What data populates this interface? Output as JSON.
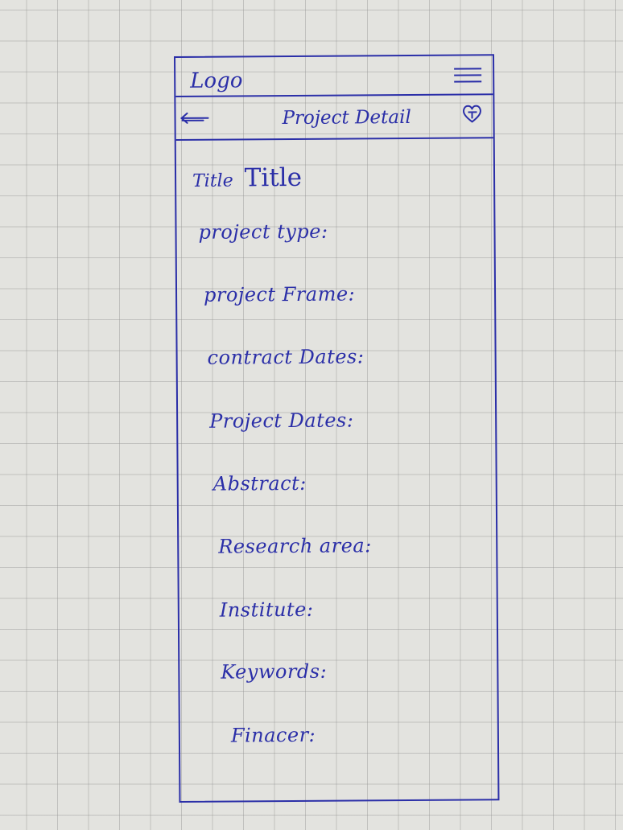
{
  "header": {
    "logo": "Logo",
    "menu_icon": "hamburger-menu-icon"
  },
  "subheader": {
    "back_icon": "back-arrow-icon",
    "title": "Project Detail",
    "favorite_icon": "heart-icon"
  },
  "detail": {
    "title_label": "Title",
    "title_value": "Title",
    "fields": [
      "project type:",
      "project Frame:",
      "contract Dates:",
      "Project Dates:",
      "Abstract:",
      "Research area:",
      "Institute:",
      "Keywords:",
      "Finacer:"
    ]
  },
  "colors": {
    "ink": "#2b2fa8",
    "paper": "#e3e3df",
    "grid": "#969696"
  }
}
